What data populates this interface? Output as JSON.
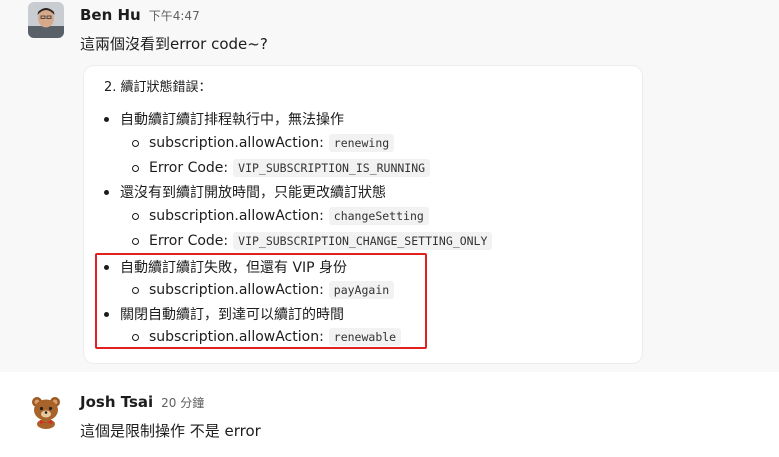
{
  "messages": [
    {
      "sender": "Ben Hu",
      "time": "下午4:47",
      "text": "這兩個沒看到error code~?",
      "attachment": {
        "heading": "2. 續訂狀態錯誤：",
        "items": [
          {
            "text": "自動續訂續訂排程執行中，無法操作",
            "sub": [
              {
                "label": "subscription.allowAction:",
                "code": "renewing"
              },
              {
                "label": "Error Code:",
                "code": "VIP_SUBSCRIPTION_IS_RUNNING"
              }
            ]
          },
          {
            "text": "還沒有到續訂開放時間，只能更改續訂狀態",
            "sub": [
              {
                "label": "subscription.allowAction:",
                "code": "changeSetting"
              },
              {
                "label": "Error Code:",
                "code": "VIP_SUBSCRIPTION_CHANGE_SETTING_ONLY"
              }
            ]
          },
          {
            "text": "自動續訂續訂失敗，但還有 VIP 身份",
            "sub": [
              {
                "label": "subscription.allowAction:",
                "code": "payAgain"
              }
            ]
          },
          {
            "text": "關閉自動續訂，到達可以續訂的時間",
            "sub": [
              {
                "label": "subscription.allowAction:",
                "code": "renewable"
              }
            ]
          }
        ]
      }
    },
    {
      "sender": "Josh Tsai",
      "time": "20 分鐘",
      "text": "這個是限制操作 不是 error"
    }
  ],
  "colors": {
    "highlight_box": "#e0211f",
    "hover_background": "#f8f8f8",
    "text": "#1d1c1d",
    "timestamp": "#616061",
    "code_background": "#f2f2f2"
  },
  "icons": {
    "ben_avatar": "user-photo-avatar",
    "josh_avatar": "bear-avatar"
  }
}
